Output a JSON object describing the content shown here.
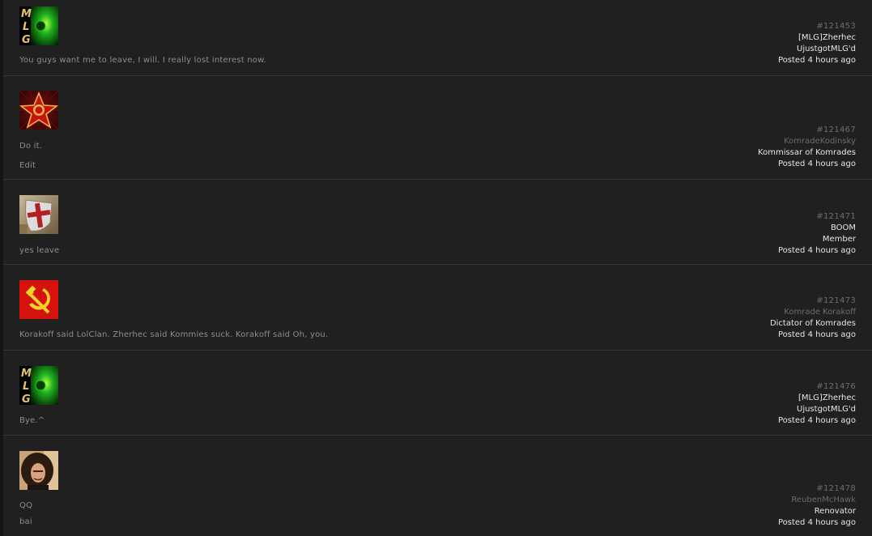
{
  "posts": [
    {
      "avatar": "mlg-logo",
      "lines": [
        "You guys want me to leave, I will. I really lost interest now."
      ],
      "id": "#121453",
      "username": "[MLG]Zherhec",
      "rank": "UjustgotMLG'd",
      "posted": "Posted 4 hours ago"
    },
    {
      "avatar": "red-star-emblem",
      "lines": [
        "Do it.",
        "Edit"
      ],
      "id": "#121467",
      "username": "KomradeKodinsky",
      "rank": "Kommissar of Komrades",
      "posted": "Posted 4 hours ago"
    },
    {
      "avatar": "crusader-shield",
      "lines": [
        "yes leave"
      ],
      "id": "#121471",
      "username": "BOOM",
      "rank": "Member",
      "posted": "Posted 4 hours ago"
    },
    {
      "avatar": "hammer-and-sickle",
      "lines": [
        "Korakoff said LolClan. Zherhec said Kommies suck. Korakoff said Oh, you."
      ],
      "id": "#121473",
      "username": "Komrade Korakoff",
      "rank": "Dictator of Komrades",
      "posted": "Posted 4 hours ago"
    },
    {
      "avatar": "mlg-logo",
      "lines": [
        "Bye.^"
      ],
      "id": "#121476",
      "username": "[MLG]Zherhec",
      "rank": "UjustgotMLG'd",
      "posted": "Posted 4 hours ago"
    },
    {
      "avatar": "curly-hair-portrait",
      "lines": [
        "QQ",
        "bai"
      ],
      "id": "#121478",
      "username": "ReubenMcHawk",
      "rank": "Renovator",
      "posted": "Posted 4 hours ago"
    }
  ]
}
